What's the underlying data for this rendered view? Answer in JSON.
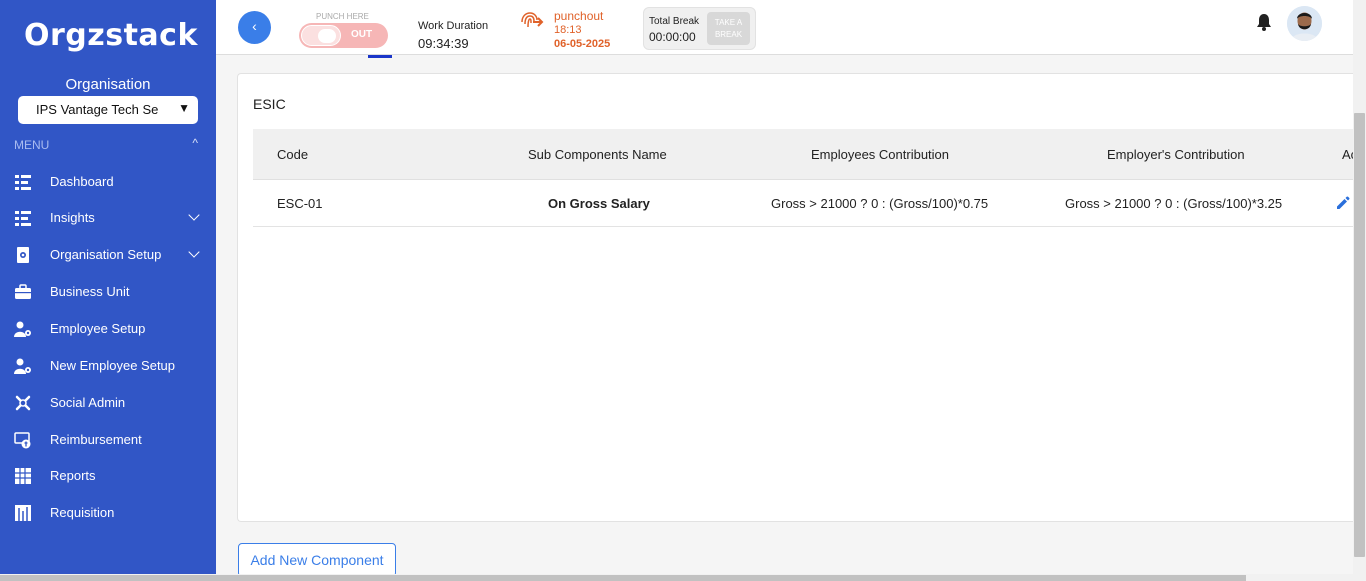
{
  "sidebar": {
    "logo": "Orgzstack",
    "org_label": "Organisation",
    "org_select_value": "IPS Vantage Tech Se",
    "menu_heading": "MENU",
    "items": [
      {
        "label": "Dashboard",
        "icon": "dashboard-icon"
      },
      {
        "label": "Insights",
        "icon": "insights-icon"
      },
      {
        "label": "Organisation Setup",
        "icon": "organisation-setup-icon"
      },
      {
        "label": "Business Unit",
        "icon": "briefcase-icon"
      },
      {
        "label": "Employee Setup",
        "icon": "employee-setup-icon"
      },
      {
        "label": "New Employee Setup",
        "icon": "new-employee-setup-icon"
      },
      {
        "label": "Social Admin",
        "icon": "social-admin-icon"
      },
      {
        "label": "Reimbursement",
        "icon": "reimbursement-icon"
      },
      {
        "label": "Reports",
        "icon": "reports-icon"
      },
      {
        "label": "Requisition",
        "icon": "requisition-icon"
      }
    ]
  },
  "topbar": {
    "back_label": "‹",
    "punch_label": "PUNCH HERE",
    "punch_state": "OUT",
    "work_duration_label": "Work Duration",
    "work_duration_value": "09:34:39",
    "punchout_label": "punchout",
    "punchout_time": "18:13",
    "punchout_date": "06-05-2025",
    "total_break_label": "Total Break",
    "total_break_value": "00:00:00",
    "take_break_label": "TAKE A BREAK"
  },
  "component": {
    "title": "ESIC",
    "columns": [
      "Code",
      "Sub Components Name",
      "Employees Contribution",
      "Employer's Contribution",
      "Ac"
    ],
    "rows": [
      {
        "code": "ESC-01",
        "name": "On Gross Salary",
        "employees": "Gross > 21000 ? 0 : (Gross/100)*0.75",
        "employer": "Gross > 21000 ? 0 : (Gross/100)*3.25"
      }
    ],
    "add_button": "Add New Component"
  },
  "colors": {
    "sidebar": "#3156c6",
    "accent": "#3a7ee8",
    "punchout": "#e0622a"
  }
}
